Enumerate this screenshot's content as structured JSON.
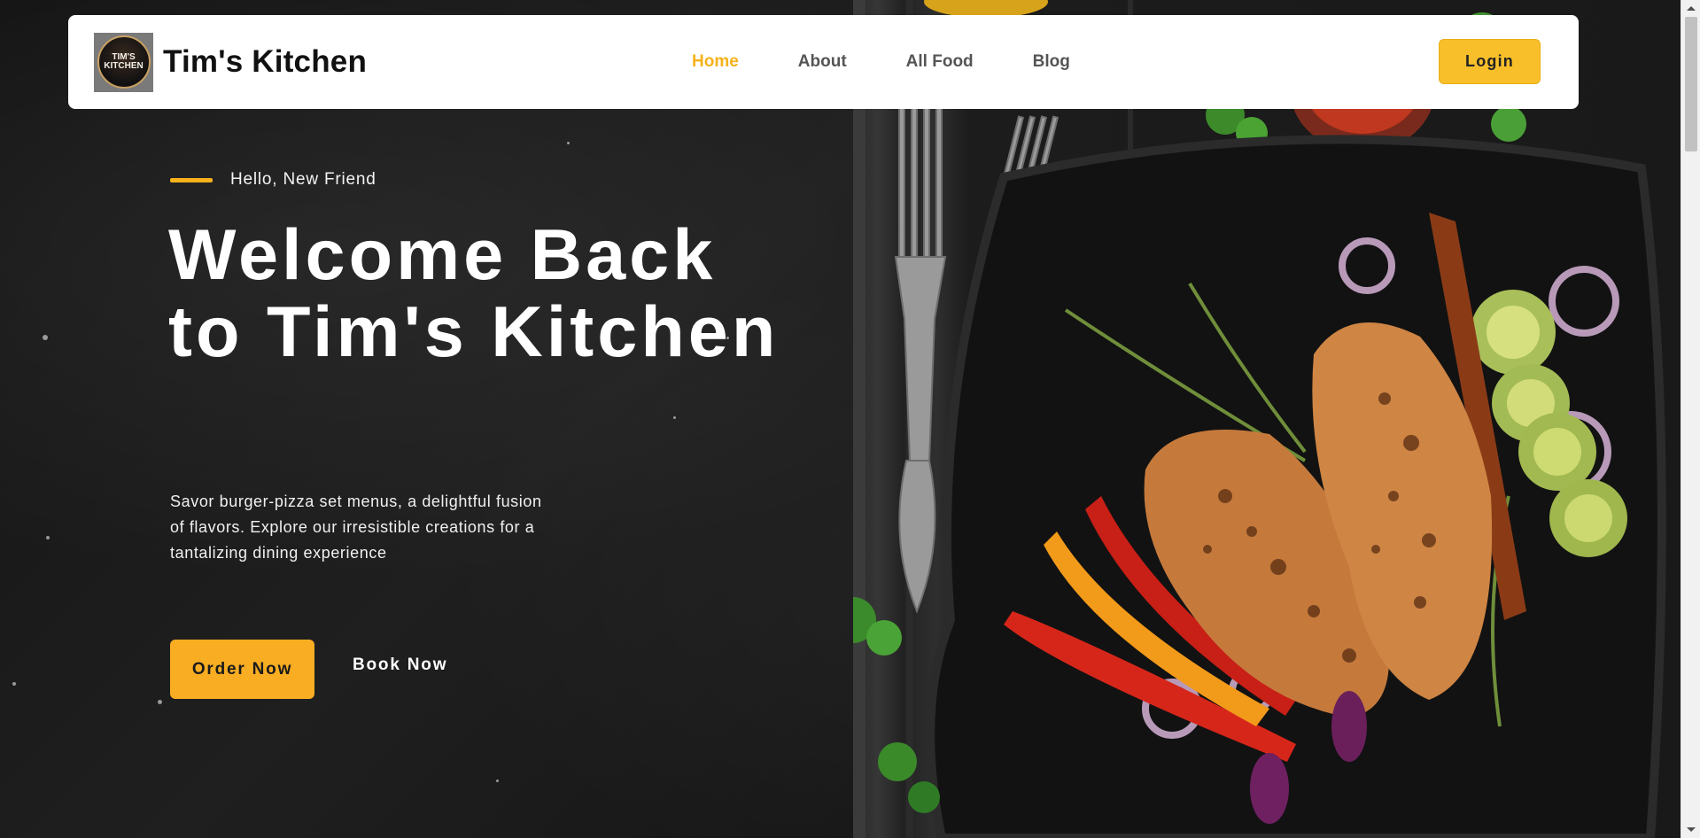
{
  "navbar": {
    "brand_name": "Tim's Kitchen",
    "logo_text": "TIM'S KITCHEN",
    "links": [
      {
        "label": "Home",
        "active": true
      },
      {
        "label": "About",
        "active": false
      },
      {
        "label": "All Food",
        "active": false
      },
      {
        "label": "Blog",
        "active": false
      }
    ],
    "login_label": "Login"
  },
  "hero": {
    "tagline": "Hello, New Friend",
    "headline": "Welcome Back to Tim's Kitchen",
    "description": "Savor burger-pizza set menus, a delightful fusion of flavors. Explore our irresistible creations for a tantalizing dining experience",
    "order_label": "Order Now",
    "book_label": "Book Now"
  },
  "colors": {
    "accent": "#f6b21b",
    "button": "#f9ad22",
    "nav_text": "#555555",
    "background": "#1a1a1a"
  },
  "icons": {
    "logo": "tims-kitchen-logo-icon",
    "hero_image": "grilled-chicken-plate-image"
  }
}
